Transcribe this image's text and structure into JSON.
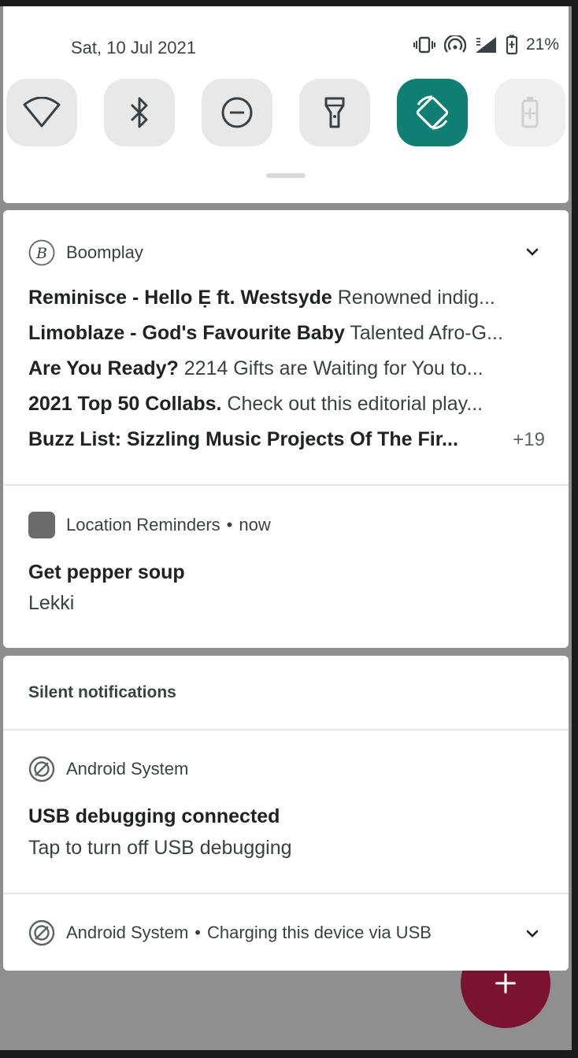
{
  "status_bar": {
    "date": "Sat, 10 Jul 2021",
    "battery_percent": "21%",
    "icons": [
      "vibrate-icon",
      "hotspot-icon",
      "signal-icon",
      "battery-icon"
    ]
  },
  "quick_settings": {
    "tiles": [
      {
        "name": "wifi",
        "icon": "wifi-icon",
        "state": "off"
      },
      {
        "name": "bluetooth",
        "icon": "bluetooth-icon",
        "state": "off"
      },
      {
        "name": "do-not-disturb",
        "icon": "dnd-icon",
        "state": "off"
      },
      {
        "name": "flashlight",
        "icon": "flashlight-icon",
        "state": "off"
      },
      {
        "name": "auto-rotate",
        "icon": "rotate-icon",
        "state": "on"
      },
      {
        "name": "battery-saver",
        "icon": "battery-saver-icon",
        "state": "disabled"
      }
    ],
    "active_color": "#0f7f73"
  },
  "notifications": {
    "boomplay": {
      "app_name": "Boomplay",
      "messages": [
        {
          "bold": "Reminisce - Hello Ẹ ft. Westsyde",
          "rest": "Renowned indig..."
        },
        {
          "bold": "Limoblaze - God's Favourite Baby",
          "rest": "Talented Afro-G..."
        },
        {
          "bold": "Are You Ready?",
          "rest": "2214 Gifts are Waiting for You to..."
        },
        {
          "bold": "2021 Top 50 Collabs.",
          "rest": "Check out this editorial play..."
        },
        {
          "bold": "Buzz List: Sizzling Music Projects Of The Fir...",
          "rest": ""
        }
      ],
      "more_count": "+19"
    },
    "location_reminders": {
      "app_name": "Location Reminders",
      "separator": "•",
      "time": "now",
      "title": "Get pepper soup",
      "body": "Lekki"
    },
    "silent_label": "Silent notifications",
    "android_usb": {
      "app_name": "Android System",
      "title": "USB debugging connected",
      "body": "Tap to turn off USB debugging"
    },
    "android_charging": {
      "app_name": "Android System",
      "separator": "•",
      "summary": "Charging this device via USB"
    }
  },
  "fab": {
    "icon": "plus-icon",
    "color": "#7a1232"
  }
}
